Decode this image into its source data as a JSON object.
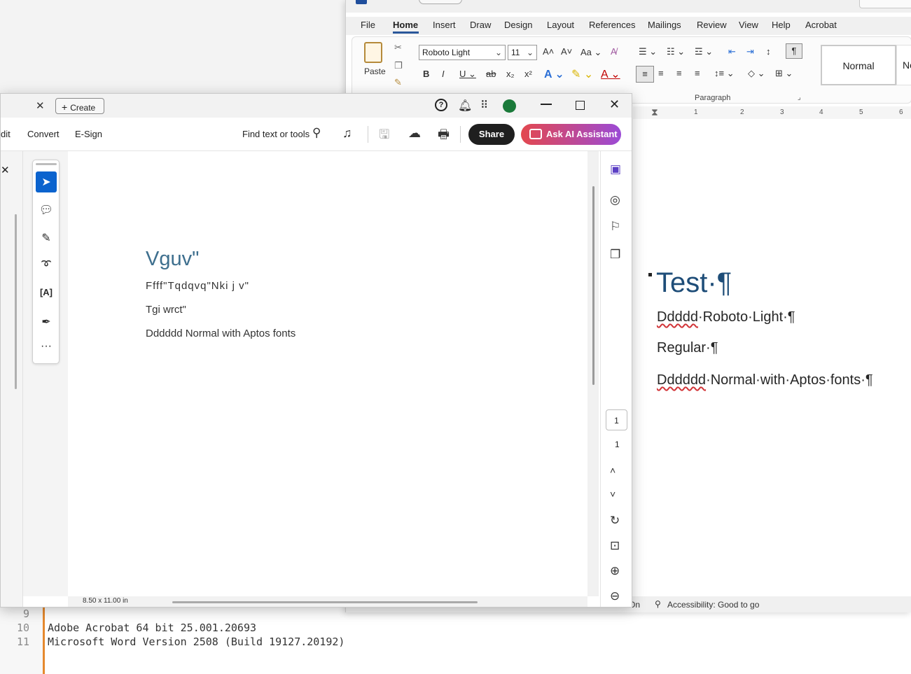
{
  "editor": {
    "lines": [
      {
        "num": "9",
        "text": ""
      },
      {
        "num": "10",
        "text": "Adobe Acrobat 64 bit 25.001.20693"
      },
      {
        "num": "11",
        "text": "Microsoft Word Version 2508 (Build 19127.20192)"
      }
    ]
  },
  "word": {
    "tabs": [
      "File",
      "Home",
      "Insert",
      "Draw",
      "Design",
      "Layout",
      "References",
      "Mailings",
      "Review",
      "View",
      "Help",
      "Acrobat"
    ],
    "active_tab": "Home",
    "paste_label": "Paste",
    "font_name": "Roboto Light",
    "font_size": "11",
    "case_label": "Aa",
    "paragraph_label": "Paragraph",
    "styles": [
      "Normal",
      "No"
    ],
    "ruler_marks": [
      "1",
      "2",
      "3",
      "4",
      "5",
      "6"
    ],
    "document": {
      "title": "Test·¶",
      "line1_word": "Ddddd",
      "line1_rest": "·Roboto·Light·¶",
      "line2": "Regular·¶",
      "line3_word": "Dddddd",
      "line3_rest": "·Normal·with·Aptos·fonts·¶"
    },
    "status_on": "On",
    "accessibility": "Accessibility: Good to go"
  },
  "acrobat": {
    "create_label": "Create",
    "menu": [
      "dit",
      "Convert",
      "E-Sign"
    ],
    "find_label": "Find text or tools",
    "share_label": "Share",
    "ai_label": "Ask AI Assistant",
    "page_content": {
      "title": "Vguv\"",
      "line1": "Ffff\"Tqdqvq\"Nki j v\"",
      "line2": "Tgi wrct\"",
      "line3": "Dddddd Normal with Aptos fonts"
    },
    "page_number": "1",
    "page_total": "1",
    "page_size": "8.50 x 11.00 in"
  },
  "colors": {
    "word_accent": "#2b579a",
    "acrobat_selected_tool": "#0b63ce",
    "ai_gradient_start": "#e3484f",
    "ai_gradient_end": "#9b4ad6",
    "word_title_color": "#1e4d78",
    "pdf_title_color": "#3e6f8e"
  }
}
